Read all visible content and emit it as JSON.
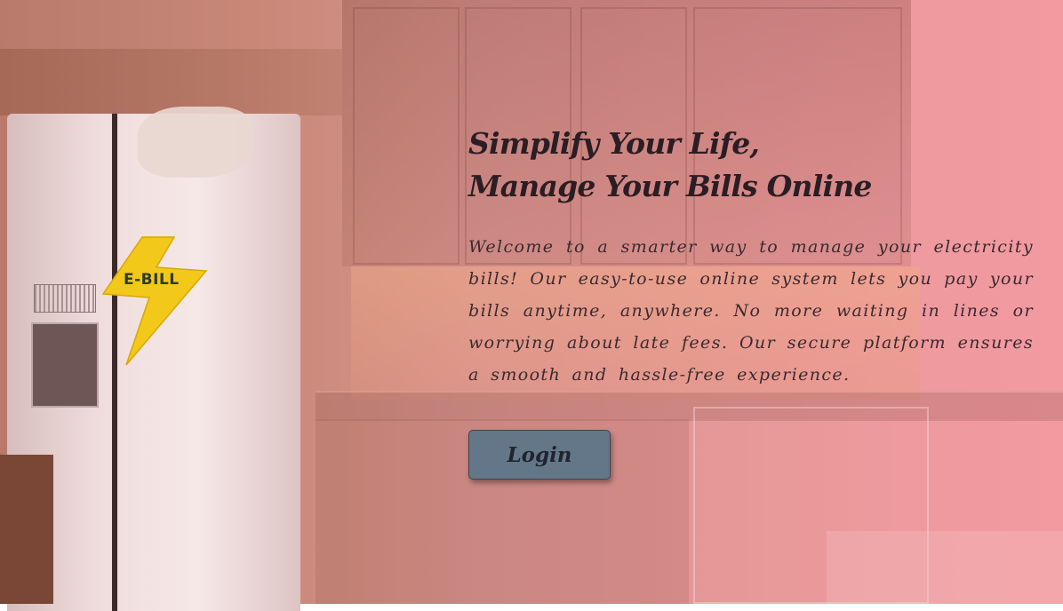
{
  "logo": {
    "text": "E-BILL",
    "icon": "lightning-bolt-icon",
    "bolt_color": "#f2c81a"
  },
  "hero": {
    "title_line1": "Simplify Your Life,",
    "title_line2": "Manage Your Bills Online",
    "description": "Welcome to a smarter way to manage your electricity bills! Our easy-to-use online system lets you pay your bills anytime, anywhere. No more waiting in lines or worrying about late fees. Our secure platform ensures a smooth and hassle-free experience."
  },
  "login_button": {
    "label": "Login",
    "color": "#647789"
  },
  "theme": {
    "overlay_color": "#f29aa0",
    "text_color": "#2b1d24"
  }
}
